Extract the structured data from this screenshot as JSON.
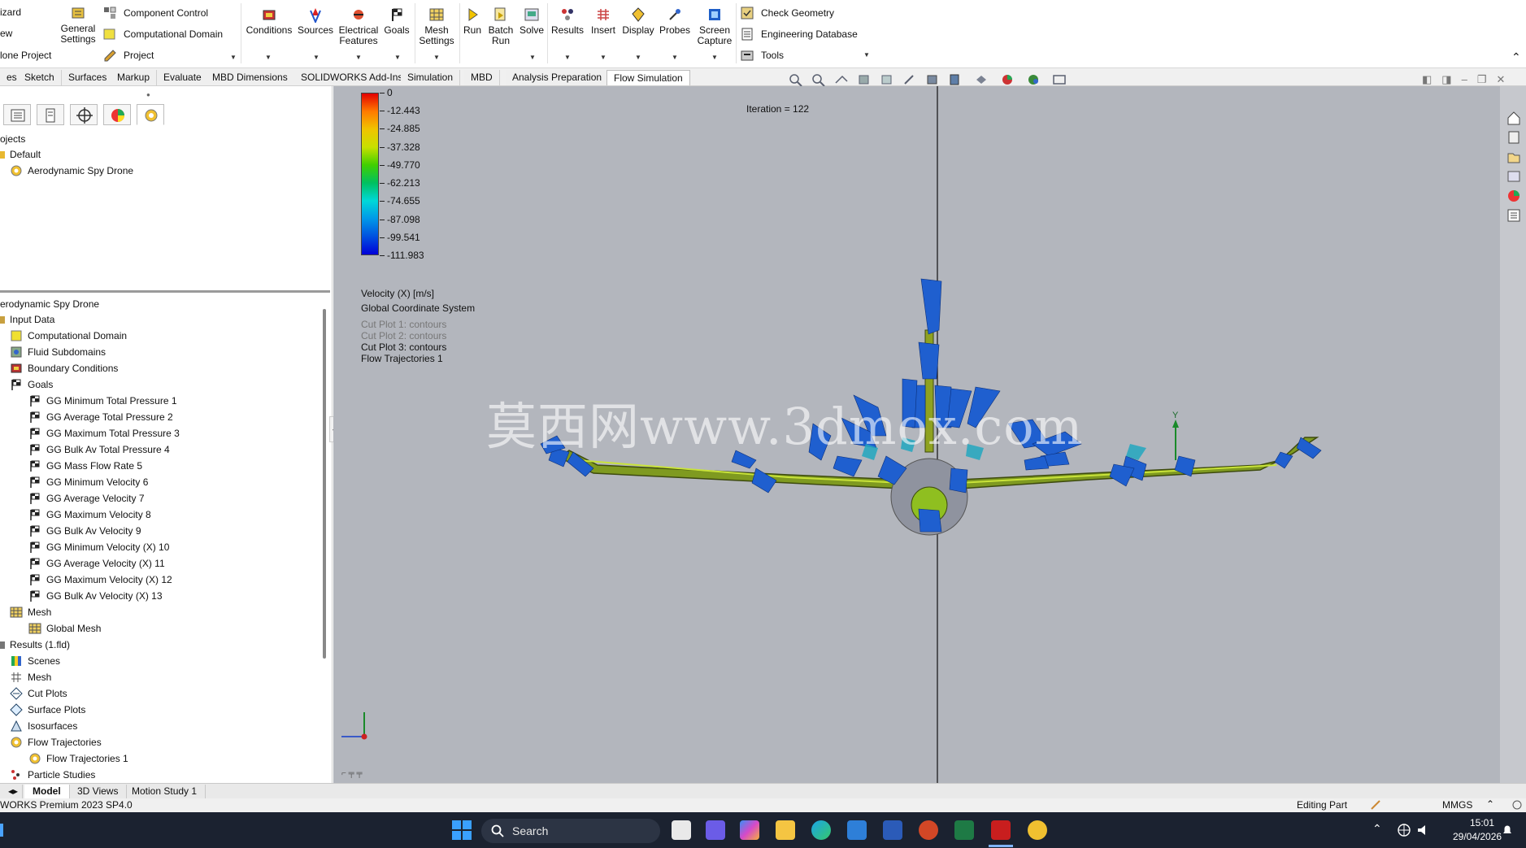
{
  "ribbon": {
    "wizard": "izard",
    "new": "ew",
    "clone_project": "lone Project",
    "general_settings": "General\nSettings",
    "component_control": "Component Control",
    "computational_domain": "Computational Domain",
    "project": "Project",
    "conditions": "Conditions",
    "sources": "Sources",
    "electrical_features": "Electrical\nFeatures",
    "goals": "Goals",
    "mesh_settings": "Mesh\nSettings",
    "run": "Run",
    "batch_run": "Batch\nRun",
    "solve": "Solve",
    "results": "Results",
    "insert": "Insert",
    "display": "Display",
    "probes": "Probes",
    "screen_capture": "Screen\nCapture",
    "check_geometry": "Check Geometry",
    "engineering_database": "Engineering Database",
    "tools": "Tools"
  },
  "command_tabs": [
    "es",
    "Sketch",
    "Surfaces",
    "Markup",
    "Evaluate",
    "MBD Dimensions",
    "SOLIDWORKS Add-Ins",
    "Simulation",
    "MBD",
    "Analysis Preparation",
    "Flow Simulation"
  ],
  "active_tab": "Flow Simulation",
  "project_tree": {
    "root": "ojects",
    "default": "Default",
    "project": "Aerodynamic Spy Drone"
  },
  "analysis_tree": {
    "root": "erodynamic Spy Drone",
    "input_data": "Input Data",
    "computational_domain": "Computational Domain",
    "fluid_subdomains": "Fluid Subdomains",
    "boundary_conditions": "Boundary Conditions",
    "goals": "Goals",
    "goal_items": [
      "GG Minimum Total Pressure 1",
      "GG Average Total Pressure 2",
      "GG Maximum Total Pressure 3",
      "GG Bulk Av Total Pressure 4",
      "GG Mass Flow Rate 5",
      "GG Minimum Velocity 6",
      "GG Average Velocity 7",
      "GG Maximum Velocity 8",
      "GG Bulk Av Velocity 9",
      "GG Minimum Velocity (X) 10",
      "GG Average Velocity (X) 11",
      "GG Maximum Velocity (X) 12",
      "GG Bulk Av Velocity (X) 13"
    ],
    "mesh": "Mesh",
    "global_mesh": "Global Mesh",
    "results": "Results (1.fld)",
    "scenes": "Scenes",
    "results_mesh": "Mesh",
    "cut_plots": "Cut Plots",
    "surface_plots": "Surface Plots",
    "isosurfaces": "Isosurfaces",
    "flow_trajectories": "Flow Trajectories",
    "flow_trajectories_1": "Flow Trajectories 1",
    "particle_studies": "Particle Studies"
  },
  "viewport": {
    "iteration": "Iteration = 122",
    "legend_values": [
      "0",
      "-12.443",
      "-24.885",
      "-37.328",
      "-49.770",
      "-62.213",
      "-74.655",
      "-87.098",
      "-99.541",
      "-111.983"
    ],
    "legend_colors": [
      "#e30000",
      "#ff7a00",
      "#f0c400",
      "#c8e000",
      "#40d000",
      "#00c060",
      "#00d8d8",
      "#0098e8",
      "#0050e0",
      "#0000d8"
    ],
    "quantity": "Velocity (X) [m/s]",
    "coordinate_system": "Global Coordinate System",
    "cut_plot_1": "Cut Plot 1: contours",
    "cut_plot_2": "Cut Plot 2: contours",
    "cut_plot_3": "Cut Plot 3: contours",
    "flow_trajectories": "Flow Trajectories 1",
    "watermark": "莫西网www.3dmox.com",
    "axis_y": "Y"
  },
  "bottom_tabs": [
    "Model",
    "3D Views",
    "Motion Study 1"
  ],
  "status": {
    "version": "WORKS Premium 2023 SP4.0",
    "editing": "Editing Part",
    "units": "MMGS"
  },
  "taskbar": {
    "search": "Search",
    "time": "15:01",
    "date": "29/04/2026"
  }
}
